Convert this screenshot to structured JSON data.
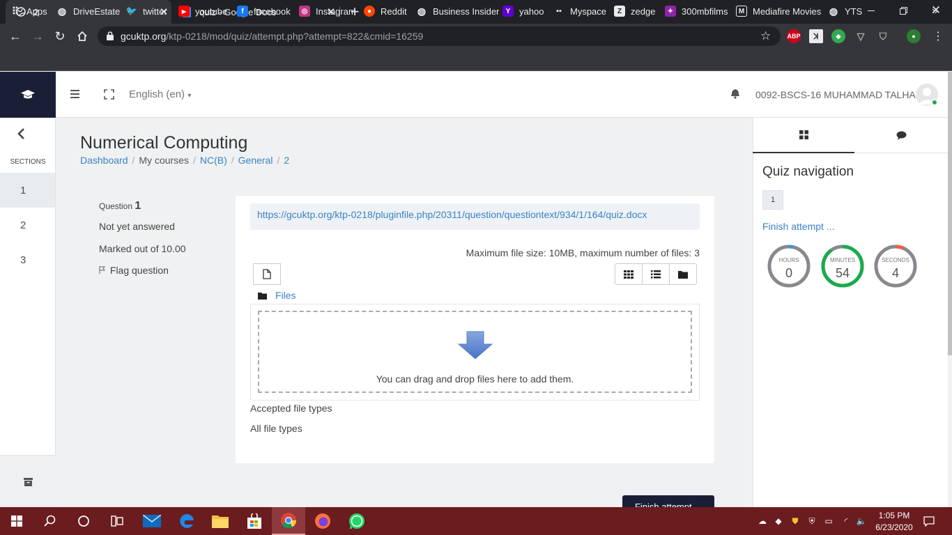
{
  "browser": {
    "tabs": [
      {
        "title": "2"
      },
      {
        "title": "quiz - Google Docs"
      }
    ],
    "url": {
      "host": "gcuktp.org",
      "path": "/ktp-0218/mod/quiz/attempt.php?attempt=822&cmid=16259"
    },
    "extensions": {
      "abp": "ABP"
    },
    "bookmarks": [
      "Apps",
      "DriveEstate",
      "twitter",
      "youtube",
      "facebook",
      "Instagram",
      "Reddit",
      "Business Insider",
      "yahoo",
      "Myspace",
      "zedge",
      "300mbfilms",
      "Mediafire Movies",
      "YTS"
    ],
    "overflow": "»"
  },
  "header": {
    "language": "English (en)",
    "user_name": "0092-BSCS-16 MUHAMMAD TALHA"
  },
  "sidebar": {
    "sections_label": "SECTIONS",
    "items": [
      "1",
      "2",
      "3"
    ]
  },
  "course": {
    "title": "Numerical Computing",
    "breadcrumb": [
      "Dashboard",
      "My courses",
      "NC(B)",
      "General",
      "2"
    ]
  },
  "question": {
    "label": "Question",
    "number": "1",
    "status": "Not yet answered",
    "marks": "Marked out of 10.00",
    "flag": "Flag question",
    "text_link": "https://gcuktp.org/ktp-0218/pluginfile.php/20311/question/questiontext/934/1/164/quiz.docx",
    "max_size": "Maximum file size: 10MB, maximum number of files: 3",
    "files_label": "Files",
    "drop_text": "You can drag and drop files here to add them.",
    "accepted_label": "Accepted file types",
    "accepted_value": "All file types"
  },
  "finish_button": "Finish attempt ...",
  "quiz_nav": {
    "title": "Quiz navigation",
    "question_buttons": [
      "1"
    ],
    "finish_link": "Finish attempt ...",
    "timer": [
      {
        "label": "HOURS",
        "value": "0",
        "progress": 0.03,
        "color": "#3a9ad9"
      },
      {
        "label": "MINUTES",
        "value": "54",
        "progress": 0.9,
        "color": "#1aab4b"
      },
      {
        "label": "SECONDS",
        "value": "4",
        "progress": 0.07,
        "color": "#e8604c"
      }
    ]
  },
  "taskbar": {
    "time": "1:05 PM",
    "date": "6/23/2020"
  }
}
